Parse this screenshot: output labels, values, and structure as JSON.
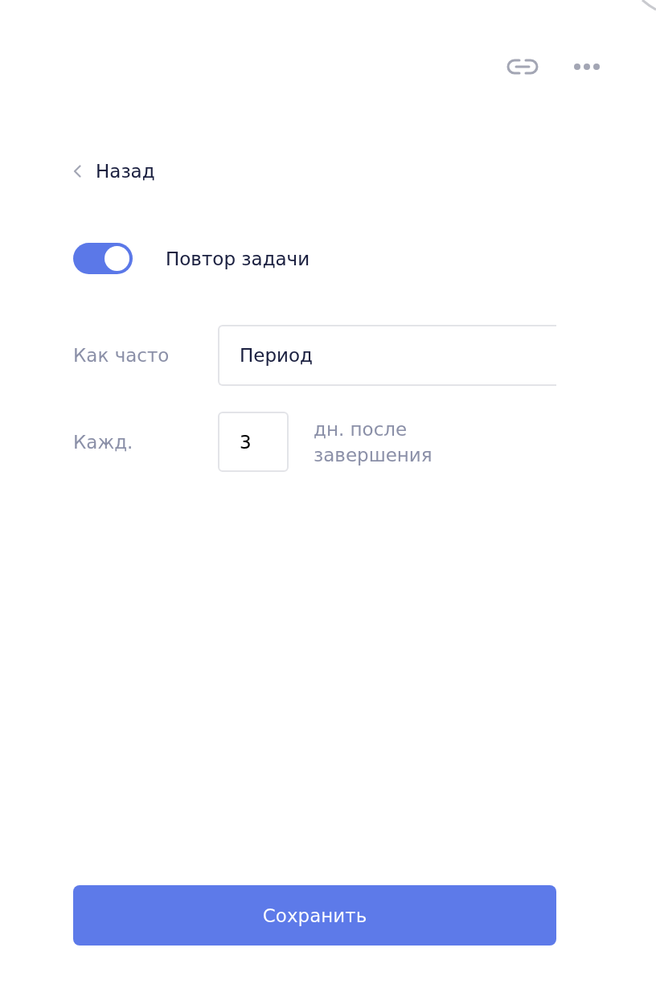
{
  "back_link": {
    "label": "Назад"
  },
  "repeat_toggle": {
    "label": "Повтор задачи",
    "on": true
  },
  "form": {
    "rows": [
      {
        "kind": "text",
        "label": "Как часто",
        "value": "Период"
      },
      {
        "kind": "number",
        "label": "Кажд.",
        "value": "3",
        "suffix": "дн. после завершения"
      }
    ]
  },
  "save_button": {
    "label": "Сохранить"
  }
}
